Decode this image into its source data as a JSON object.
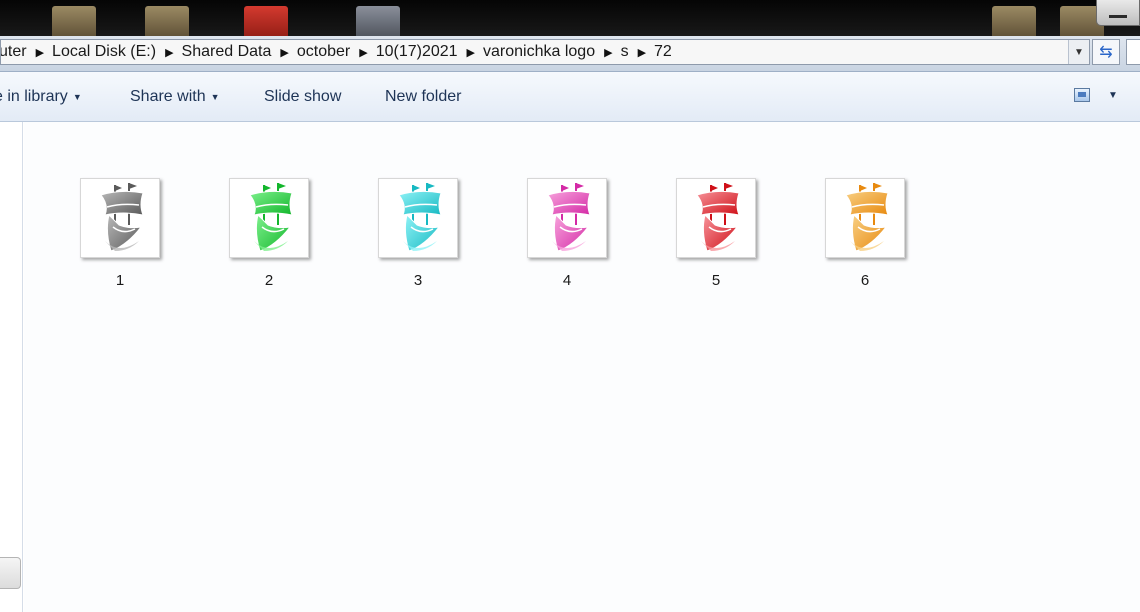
{
  "breadcrumb": {
    "items": [
      "uter",
      "Local Disk (E:)",
      "Shared Data",
      "october",
      "10(17)2021",
      "varonichka logo",
      "s",
      "72"
    ]
  },
  "toolbar": {
    "include_in_library": "e in library",
    "share_with": "Share with",
    "slide_show": "Slide show",
    "new_folder": "New folder"
  },
  "icons": {
    "address_dropdown": "chevron-down-icon",
    "refresh": "refresh-icon",
    "view": "view-options-icon"
  },
  "files": [
    {
      "name": "1",
      "color": "#5a5a5a",
      "light": "#b8b8b8"
    },
    {
      "name": "2",
      "color": "#13b62c",
      "light": "#7df08c"
    },
    {
      "name": "3",
      "color": "#17b9c2",
      "light": "#8ff2f6"
    },
    {
      "name": "4",
      "color": "#d42aa6",
      "light": "#f7a3dc"
    },
    {
      "name": "5",
      "color": "#cf1018",
      "light": "#f7939a"
    },
    {
      "name": "6",
      "color": "#e88a10",
      "light": "#f8cf83"
    }
  ]
}
